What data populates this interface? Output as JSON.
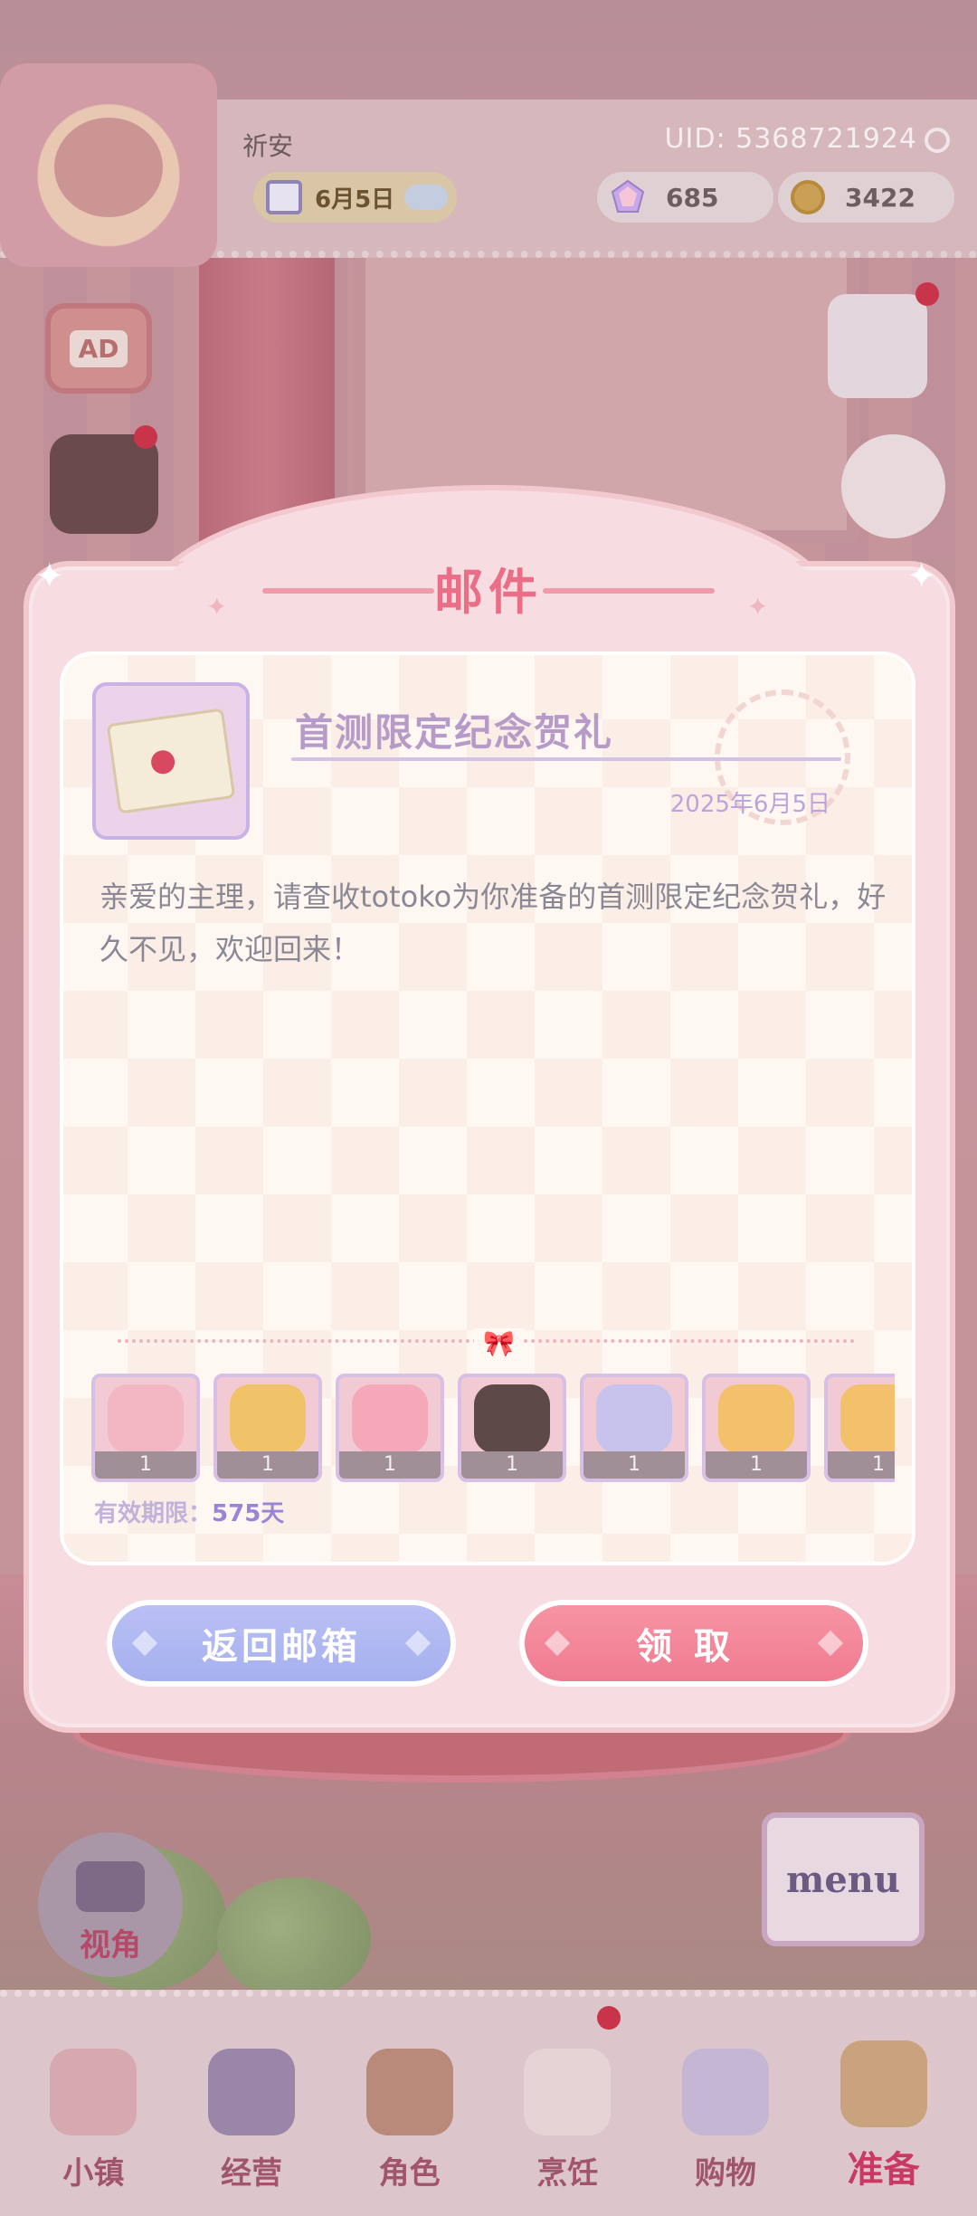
{
  "hud": {
    "player_name": "祈安",
    "uid": "UID: 5368721924",
    "date": "6月5日",
    "gems": "685",
    "coins": "3422"
  },
  "side_buttons": {
    "ad_label": "AD"
  },
  "mail": {
    "title": "邮件",
    "subject": "首测限定纪念贺礼",
    "date": "2025年6月5日",
    "body": "亲爱的主理，请查收totoko为你准备的首测限定纪念贺礼，好久不见，欢迎回来！",
    "items": [
      {
        "name": "pink-dress-outfit",
        "qty": "1",
        "color": "#f3b7c3"
      },
      {
        "name": "golden-crown-frame",
        "qty": "1",
        "color": "#f1c368"
      },
      {
        "name": "pink-frilly-dress",
        "qty": "1",
        "color": "#f4a8b9"
      },
      {
        "name": "black-maid-dress",
        "qty": "1",
        "color": "#5d4a48"
      },
      {
        "name": "hamster-plush",
        "qty": "1",
        "color": "#c7c3ec"
      },
      {
        "name": "girl-avatar-frame",
        "qty": "1",
        "color": "#f3c06c"
      },
      {
        "name": "girl-avatar-frame-2",
        "qty": "1",
        "color": "#f3c06c"
      }
    ],
    "expire_label": "有效期限：",
    "expire_value": "575天",
    "back_button": "返回邮箱",
    "claim_button": "领取"
  },
  "scene": {
    "camera_label": "视角",
    "menu_label": "menu"
  },
  "nav": [
    {
      "label": "小镇",
      "icon": "map-icon"
    },
    {
      "label": "经营",
      "icon": "shop-bag-icon"
    },
    {
      "label": "角色",
      "icon": "character-icon"
    },
    {
      "label": "烹饪",
      "icon": "cooking-icon"
    },
    {
      "label": "购物",
      "icon": "shopping-bag-icon"
    },
    {
      "label": "准备",
      "icon": "basket-icon"
    }
  ],
  "colors": {
    "accent_pink": "#ea6e85",
    "claim_button": "#f07b90",
    "back_button": "#a6b0ef",
    "subject_text": "#b69bc9"
  }
}
